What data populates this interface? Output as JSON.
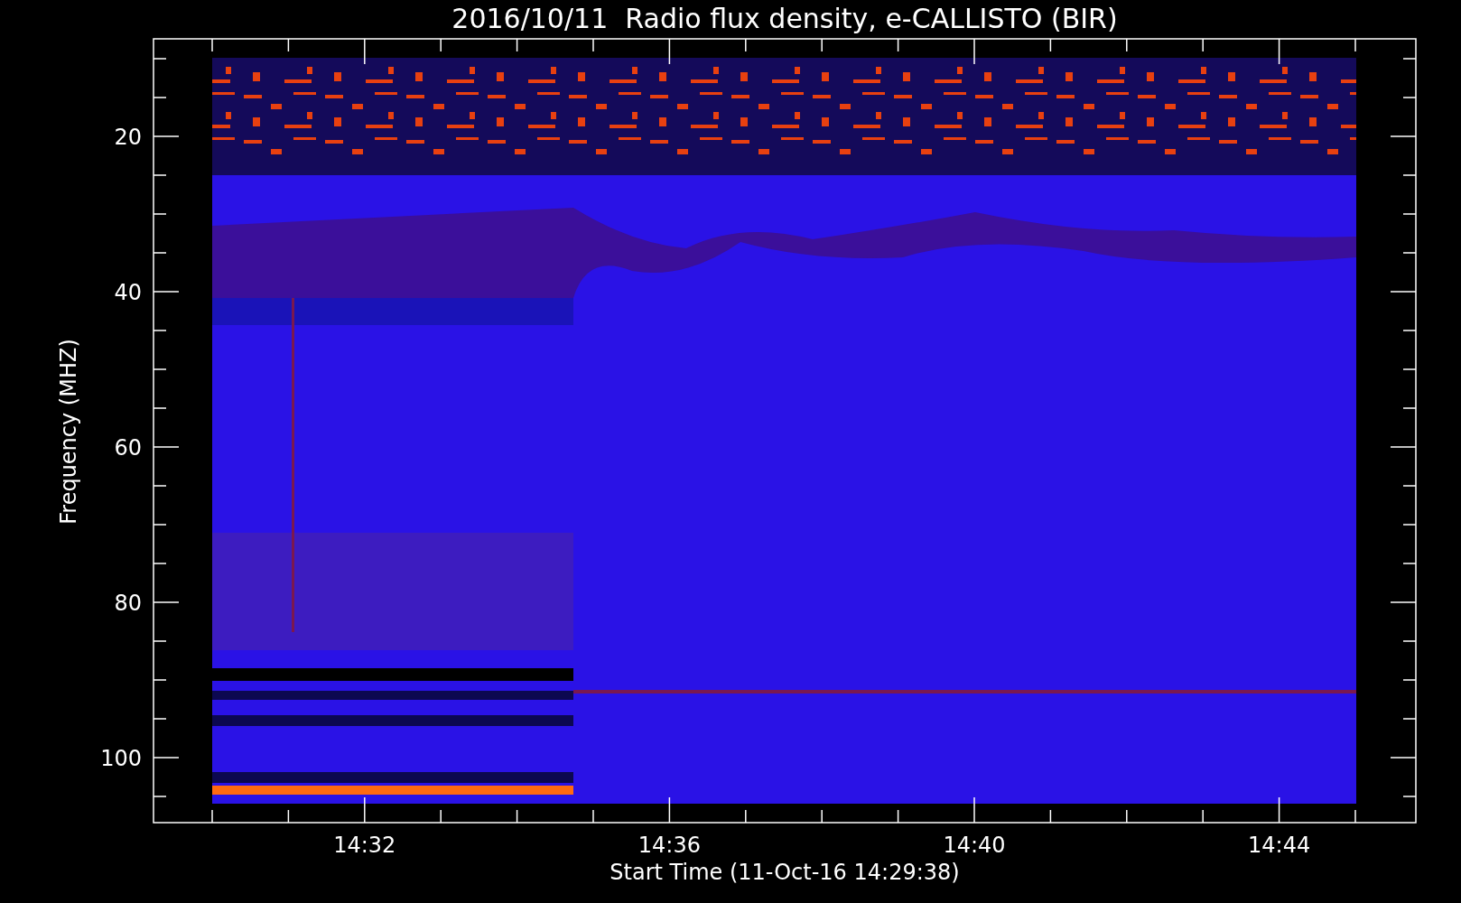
{
  "title": "2016/10/11  Radio flux density, e-CALLISTO (BIR)",
  "y_axis": {
    "label": "Frequency (MHZ)",
    "ticks": [
      "20",
      "40",
      "60",
      "80",
      "100"
    ]
  },
  "x_axis": {
    "label": "Start Time (11-Oct-16 14:29:38)",
    "ticks": [
      "14:32",
      "14:36",
      "14:40",
      "14:44"
    ]
  }
}
